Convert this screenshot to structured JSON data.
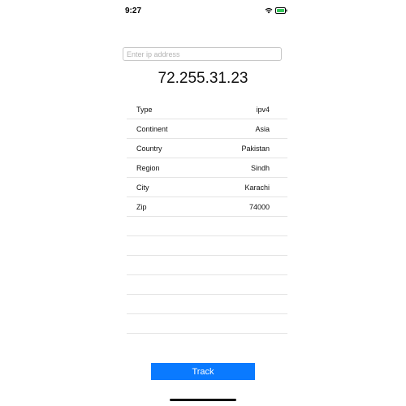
{
  "status_bar": {
    "time": "9:27",
    "icons": [
      "wifi-icon",
      "battery-icon"
    ],
    "battery_color": "#34c759"
  },
  "search": {
    "placeholder": "Enter ip address",
    "value": ""
  },
  "ip_address": "72.255.31.23",
  "details": {
    "rows": [
      {
        "label": "Type",
        "value": "ipv4"
      },
      {
        "label": "Continent",
        "value": "Asia"
      },
      {
        "label": "Country",
        "value": "Pakistan"
      },
      {
        "label": "Region",
        "value": "Sindh"
      },
      {
        "label": "City",
        "value": "Karachi"
      },
      {
        "label": "Zip",
        "value": "74000"
      }
    ]
  },
  "track_button": {
    "label": "Track",
    "color": "#0a7aff"
  }
}
